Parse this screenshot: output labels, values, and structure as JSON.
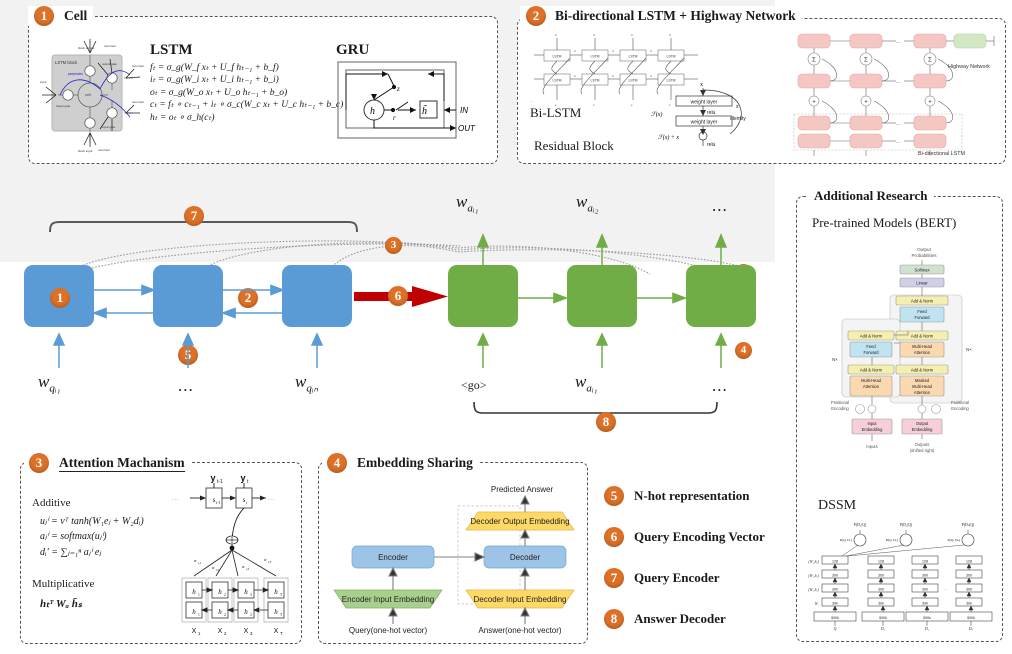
{
  "panels": {
    "cell": {
      "number": "1",
      "title": "Cell",
      "lstm_heading": "LSTM",
      "gru_heading": "GRU",
      "lstm_block_label": "LSTM block",
      "lstm_equations": [
        "fₜ = σ_g(W_f xₜ + U_f hₜ₋₁ + b_f)",
        "iₜ = σ_g(W_i xₜ + U_i hₜ₋₁ + b_i)",
        "oₜ = σ_g(W_o xₜ + U_o hₜ₋₁ + b_o)",
        "cₜ = fₜ ∘ cₜ₋₁ + iₜ ∘ σ_c(W_c xₜ + U_c hₜ₋₁ + b_c)",
        "hₜ = oₜ ∘ σ_h(cₜ)"
      ],
      "gru_nodes": {
        "h": "h",
        "z": "z",
        "r": "r",
        "htilde": "h̃"
      },
      "gru_io": {
        "in": "IN",
        "out": "OUT"
      },
      "lstm_fig_labels": [
        "block output",
        "peepholes",
        "output gate",
        "cell",
        "forget gate",
        "input gate",
        "block input",
        "input",
        "recurrent"
      ]
    },
    "bilstm": {
      "number": "2",
      "title": "Bi-directional LSTM + Highway Network",
      "bilstm_label": "Bi-LSTM",
      "residual_label": "Residual Block",
      "residual_nodes": [
        "x",
        "weight layer",
        "relu",
        "weight layer",
        "relu"
      ],
      "residual_fx": "ℱ(x)",
      "residual_identity_top": "x",
      "residual_identity": "identity",
      "residual_sum": "ℱ(x) + x",
      "highway_label": "Highway Network",
      "bidir_label": "Bi-directional LSTM",
      "sigma": "Σ",
      "plus": "+",
      "cell_label": "LSTM",
      "ellipsis": "..."
    },
    "attention": {
      "number": "3",
      "title": "Attention Machanism",
      "additive_label": "Additive",
      "multiplicative_label": "Multiplicative",
      "additive_eqs": [
        "uⱼⁱ  =   vᵀ tanh(W₁eⱼ + W₂dᵢ)",
        "aⱼⁱ  =   softmax(uⱼⁱ)",
        "dᵢ′  =   ∑ⱼ₌₁ⁿ aⱼⁱ eⱼ"
      ],
      "multiplicative_eq": "hₜᵀ Wₐ h̄ₛ",
      "fig_nodes": {
        "y_prev": "y",
        "y_prev_sub": "t-1",
        "y_cur": "y",
        "y_cur_sub": "t",
        "s_prev": "s",
        "s_prev_sub": "t-1",
        "s_cur": "s",
        "s_cur_sub": "t",
        "alphas": [
          "α",
          "α",
          "α",
          "α"
        ],
        "alpha_subs": [
          "t,1",
          "t,2",
          "t,3",
          "t,T"
        ],
        "h_labels": [
          "h₁",
          "h₂",
          "h₃",
          "hₜ"
        ],
        "x_labels": [
          "X₁",
          "X₂",
          "X₃",
          "Xₜ"
        ]
      }
    },
    "embedding": {
      "number": "4",
      "title": "Embedding Sharing",
      "nodes": {
        "predicted_answer": "Predicted Answer",
        "decoder_output_embedding": "Decoder Output Embedding",
        "encoder": "Encoder",
        "decoder": "Decoder",
        "encoder_input_embedding": "Encoder Input Embedding",
        "decoder_input_embedding": "Decoder Input Embedding",
        "query_input": "Query(one-hot vector)",
        "answer_input": "Answer(one-hot vector)"
      }
    },
    "additional": {
      "title": "Additional Research",
      "bert_heading": "Pre-trained Models (BERT)",
      "dssm_heading": "DSSM",
      "transformer_labels": {
        "output_probabilities": "Output\nProbabilities",
        "softmax": "Softmax",
        "linear": "Linear",
        "add_norm": "Add & Norm",
        "feed_forward": "Feed\nForward",
        "multi_head_attention": "Multi-Head\nAttention",
        "masked_multi_head_attention": "Masked\nMulti-Head\nAttention",
        "nx": "N×",
        "positional_encoding": "Positional\nEncoding",
        "input_embedding": "Input\nEmbedding",
        "output_embedding": "Output\nEmbedding",
        "inputs": "Inputs",
        "outputs": "Outputs",
        "outputs_shifted": "(shifted right)"
      },
      "dssm_labels": {
        "posterior": [
          "P(D₁|Q)",
          "P(D₂|Q)",
          "P(Dₙ|Q)"
        ],
        "relevance": [
          "R(Q, D₁)",
          "R(Q, D₂)",
          "R(Q, Dₙ)"
        ],
        "layer_sizes": [
          "128",
          "300",
          "300",
          "30k",
          "500k"
        ],
        "weights": [
          "(W₄,b₄)",
          "(W₃,b₃)",
          "(W₂,b₂)",
          "W₁"
        ],
        "bottom": [
          "Q",
          "D₁",
          "D₂",
          "Dₙ"
        ],
        "ellipsis": "..."
      }
    }
  },
  "diagram": {
    "encoder_inputs": [
      "w",
      "...",
      "w"
    ],
    "encoder_input_subs": [
      "qᵢ₁",
      "",
      "qᵢₙ"
    ],
    "decoder_outputs_top": [
      "w",
      "w",
      "..."
    ],
    "decoder_output_subs": [
      "aᵢ₁",
      "aᵢ₂",
      ""
    ],
    "decoder_inputs": [
      "<go>",
      "w",
      "..."
    ],
    "decoder_input_subs": [
      "",
      "aᵢ₁",
      ""
    ],
    "markers": {
      "cell": "1",
      "bilstm": "2",
      "attention": "3",
      "embedding": "4",
      "nhot": "5",
      "query_vec": "6",
      "query_encoder": "7",
      "answer_decoder": "8"
    },
    "colors": {
      "encoder": "#5B9BD5",
      "decoder": "#70AD47",
      "accent": "#DD7127",
      "vector": "#C00000",
      "stage_bg": "#F2F2F2"
    }
  },
  "legend": [
    {
      "number": "5",
      "label": "N-hot representation"
    },
    {
      "number": "6",
      "label": "Query Encoding Vector"
    },
    {
      "number": "7",
      "label": "Query Encoder"
    },
    {
      "number": "8",
      "label": "Answer Decoder"
    }
  ]
}
